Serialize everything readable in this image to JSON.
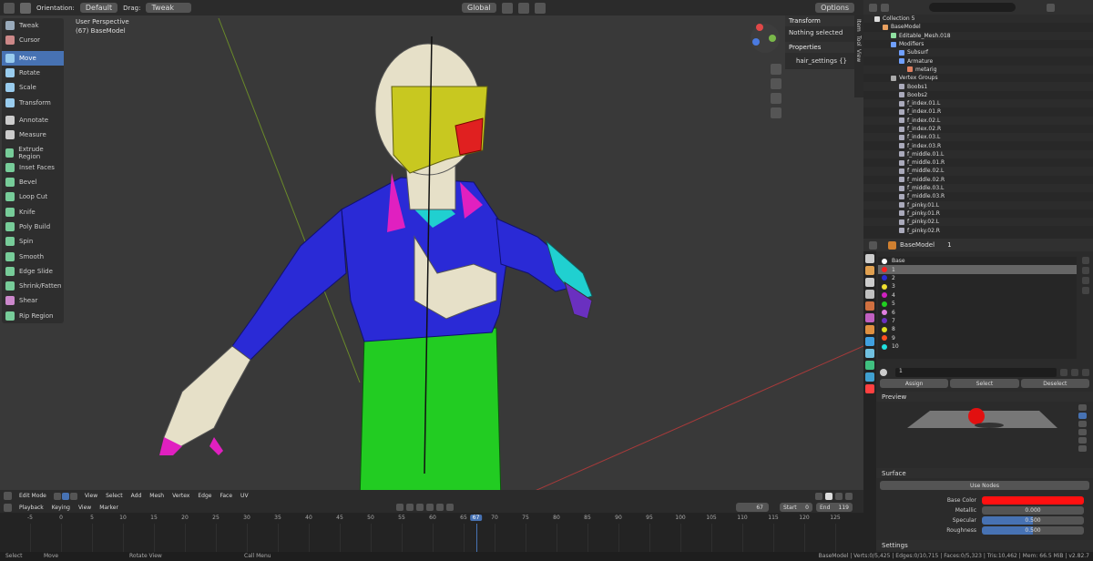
{
  "topbar": {
    "orientation_label": "Orientation:",
    "orientation_value": "Default",
    "drag_label": "Drag:",
    "drag_value": "Tweak",
    "transform_space": "Global",
    "options_label": "Options"
  },
  "viewport": {
    "perspective": "User Perspective",
    "object_info": "(67) BaseModel",
    "mode": "Edit Mode",
    "menus": [
      "View",
      "Select",
      "Add",
      "Mesh",
      "Vertex",
      "Edge",
      "Face",
      "UV"
    ]
  },
  "tools": [
    {
      "label": "Tweak",
      "color": "#9ab",
      "active": false
    },
    {
      "label": "Cursor",
      "color": "#c88",
      "active": false
    },
    {
      "label": "Move",
      "color": "#9ce",
      "active": true
    },
    {
      "label": "Rotate",
      "color": "#9ce",
      "active": false
    },
    {
      "label": "Scale",
      "color": "#9ce",
      "active": false
    },
    {
      "label": "Transform",
      "color": "#9ce",
      "active": false
    },
    {
      "label": "Annotate",
      "color": "#ccc",
      "active": false
    },
    {
      "label": "Measure",
      "color": "#ccc",
      "active": false
    },
    {
      "label": "Extrude Region",
      "color": "#7c9",
      "active": false
    },
    {
      "label": "Inset Faces",
      "color": "#7c9",
      "active": false
    },
    {
      "label": "Bevel",
      "color": "#7c9",
      "active": false
    },
    {
      "label": "Loop Cut",
      "color": "#7c9",
      "active": false
    },
    {
      "label": "Knife",
      "color": "#7c9",
      "active": false
    },
    {
      "label": "Poly Build",
      "color": "#7c9",
      "active": false
    },
    {
      "label": "Spin",
      "color": "#7c9",
      "active": false
    },
    {
      "label": "Smooth",
      "color": "#7c9",
      "active": false
    },
    {
      "label": "Edge Slide",
      "color": "#7c9",
      "active": false
    },
    {
      "label": "Shrink/Fatten",
      "color": "#7c9",
      "active": false
    },
    {
      "label": "Shear",
      "color": "#c8c",
      "active": false
    },
    {
      "label": "Rip Region",
      "color": "#7c9",
      "active": false
    }
  ],
  "npanel": {
    "transform_title": "Transform",
    "nothing_selected": "Nothing selected",
    "properties_title": "Properties",
    "hair_settings": "hair_settings",
    "hair_value": "{}",
    "tabs": [
      "Item",
      "Tool",
      "View"
    ]
  },
  "outliner": {
    "rows": [
      {
        "label": "Collection 5",
        "indent": 0
      },
      {
        "label": "BaseModel",
        "indent": 1
      },
      {
        "label": "Editable_Mesh.018",
        "indent": 2
      },
      {
        "label": "Modifiers",
        "indent": 2
      },
      {
        "label": "Subsurf",
        "indent": 3
      },
      {
        "label": "Armature",
        "indent": 3
      },
      {
        "label": "metarig",
        "indent": 4
      },
      {
        "label": "Vertex Groups",
        "indent": 2
      },
      {
        "label": "Boobs1",
        "indent": 3
      },
      {
        "label": "Boobs2",
        "indent": 3
      },
      {
        "label": "f_index.01.L",
        "indent": 3
      },
      {
        "label": "f_index.01.R",
        "indent": 3
      },
      {
        "label": "f_index.02.L",
        "indent": 3
      },
      {
        "label": "f_index.02.R",
        "indent": 3
      },
      {
        "label": "f_index.03.L",
        "indent": 3
      },
      {
        "label": "f_index.03.R",
        "indent": 3
      },
      {
        "label": "f_middle.01.L",
        "indent": 3
      },
      {
        "label": "f_middle.01.R",
        "indent": 3
      },
      {
        "label": "f_middle.02.L",
        "indent": 3
      },
      {
        "label": "f_middle.02.R",
        "indent": 3
      },
      {
        "label": "f_middle.03.L",
        "indent": 3
      },
      {
        "label": "f_middle.03.R",
        "indent": 3
      },
      {
        "label": "f_pinky.01.L",
        "indent": 3
      },
      {
        "label": "f_pinky.01.R",
        "indent": 3
      },
      {
        "label": "f_pinky.02.L",
        "indent": 3
      },
      {
        "label": "f_pinky.02.R",
        "indent": 3
      }
    ]
  },
  "properties": {
    "object_name": "BaseModel",
    "slot_count": "1",
    "slots": [
      {
        "label": "Base",
        "color": "#ffffff"
      },
      {
        "label": "1",
        "color": "#ff2020"
      },
      {
        "label": "2",
        "color": "#2a2ad6"
      },
      {
        "label": "3",
        "color": "#f0e030"
      },
      {
        "label": "4",
        "color": "#d020c0"
      },
      {
        "label": "5",
        "color": "#20d020"
      },
      {
        "label": "6",
        "color": "#e080e0"
      },
      {
        "label": "7",
        "color": "#6a30c0"
      },
      {
        "label": "8",
        "color": "#e0e020"
      },
      {
        "label": "9",
        "color": "#ff5020"
      },
      {
        "label": "10",
        "color": "#20e0e0"
      }
    ],
    "material_name": "1",
    "assign": "Assign",
    "select": "Select",
    "deselect": "Deselect",
    "preview_title": "Preview",
    "surface_title": "Surface",
    "use_nodes": "Use Nodes",
    "base_color_label": "Base Color",
    "base_color": "#ff1010",
    "metallic_label": "Metallic",
    "metallic_value": "0.000",
    "specular_label": "Specular",
    "specular_value": "0.500",
    "roughness_label": "Roughness",
    "roughness_value": "0.500",
    "settings_title": "Settings"
  },
  "timeline": {
    "menus": [
      "Playback",
      "Keying",
      "View",
      "Marker"
    ],
    "current_frame": "67",
    "start_label": "Start",
    "start_value": "0",
    "end_label": "End",
    "end_value": "119",
    "ticks": [
      "-5",
      "0",
      "5",
      "10",
      "15",
      "20",
      "25",
      "30",
      "35",
      "40",
      "45",
      "50",
      "55",
      "60",
      "65",
      "67",
      "70",
      "75",
      "80",
      "85",
      "90",
      "95",
      "100",
      "105",
      "110",
      "115",
      "120",
      "125"
    ]
  },
  "statusbar": {
    "select": "Select",
    "move": "Move",
    "rotate": "Rotate View",
    "call_menu": "Call Menu",
    "stats": "BaseModel | Verts:0/5,425 | Edges:0/10,715 | Faces:0/5,323 | Tris:10,462 | Mem: 66.5 MiB | v2.82.7"
  }
}
